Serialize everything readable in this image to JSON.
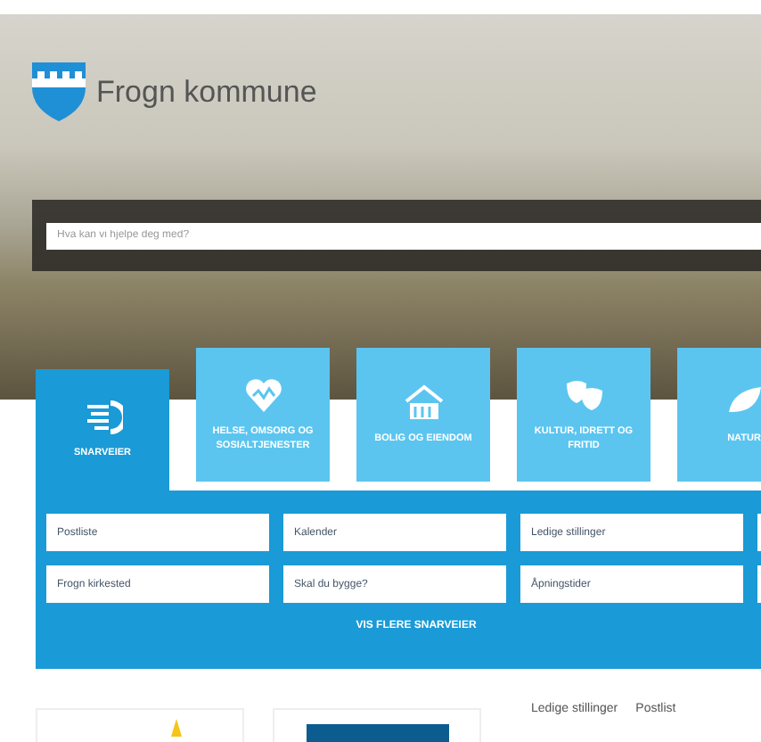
{
  "header": {
    "logo_text": "Frogn kommune",
    "search": {
      "placeholder": "Hva kan vi hjelpe deg med?"
    }
  },
  "categories": [
    {
      "kind": "speed",
      "label": "SNARVEIER",
      "selected": true
    },
    {
      "kind": "heart",
      "label": "HELSE, OMSORG OG SOSIALTJENESTER",
      "selected": false
    },
    {
      "kind": "house",
      "label": "BOLIG OG EIENDOM",
      "selected": false
    },
    {
      "kind": "masks",
      "label": "KULTUR, IDRETT OG FRITID",
      "selected": false
    },
    {
      "kind": "leaf",
      "label": "NATUR",
      "selected": false
    }
  ],
  "shortcuts": [
    "Postliste",
    "Kalender",
    "Ledige stillinger",
    "Frogn kirkested",
    "Skal du bygge?",
    "Åpningstider"
  ],
  "more_link": "VIS FLERE SNARVEIER",
  "footer_links": [
    "Ledige stillinger",
    "Postlist"
  ]
}
